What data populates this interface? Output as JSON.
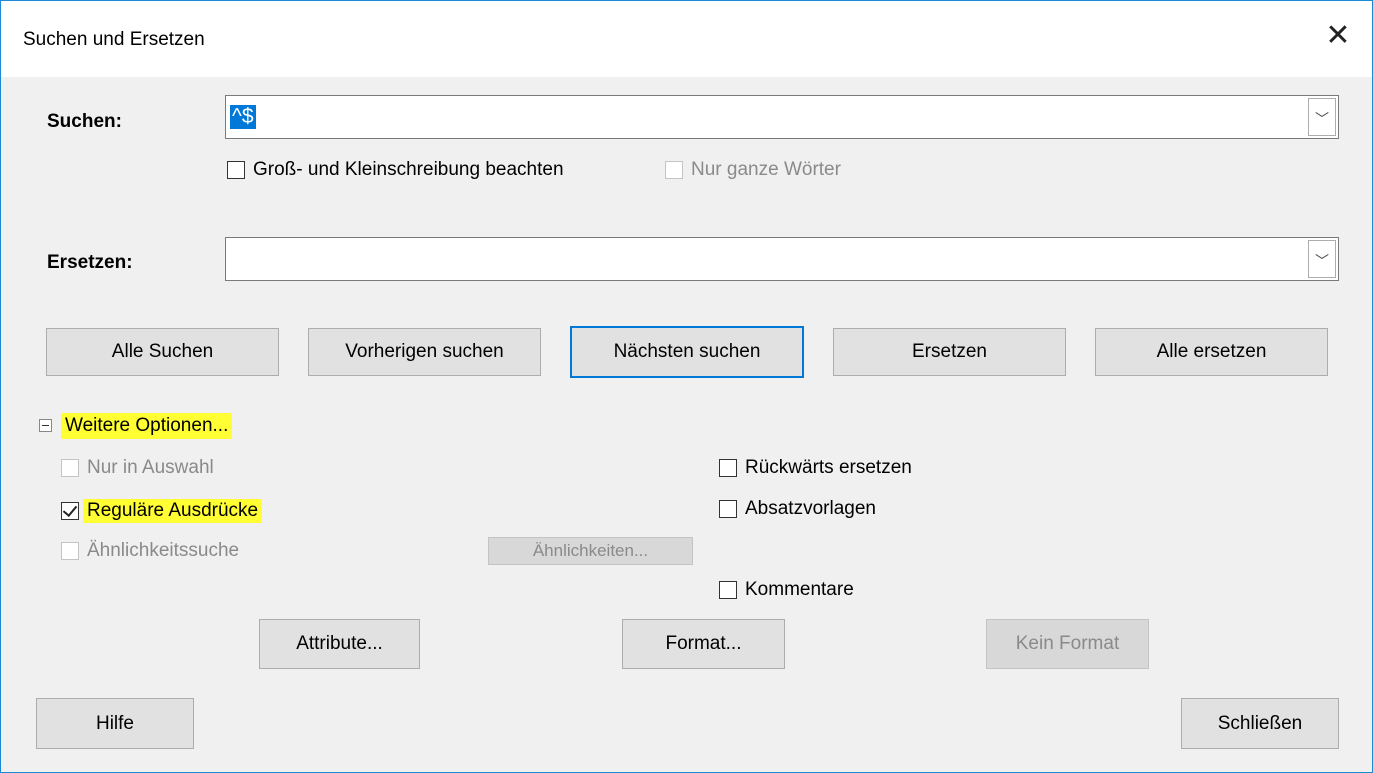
{
  "window": {
    "title": "Suchen und Ersetzen"
  },
  "search": {
    "label": "Suchen:",
    "value": "^$"
  },
  "match_case": {
    "label": "Groß- und Kleinschreibung beachten",
    "checked": false
  },
  "whole_words": {
    "label": "Nur ganze Wörter",
    "checked": false,
    "disabled": true
  },
  "replace": {
    "label": "Ersetzen:",
    "value": ""
  },
  "buttons": {
    "find_all": "Alle Suchen",
    "find_prev": "Vorherigen suchen",
    "find_next": "Nächsten suchen",
    "replace": "Ersetzen",
    "replace_all": "Alle ersetzen"
  },
  "more_options": {
    "label": "Weitere Optionen..."
  },
  "options": {
    "selection_only": "Nur in Auswahl",
    "regex": "Reguläre Ausdrücke",
    "similarity": "Ähnlichkeitssuche",
    "similarities_btn": "Ähnlichkeiten...",
    "backwards": "Rückwärts ersetzen",
    "para_styles": "Absatzvorlagen",
    "comments": "Kommentare"
  },
  "format_buttons": {
    "attributes": "Attribute...",
    "format": "Format...",
    "no_format": "Kein Format"
  },
  "footer": {
    "help": "Hilfe",
    "close": "Schließen"
  },
  "colors": {
    "accent": "#0078d7",
    "highlight": "#ffff33"
  }
}
